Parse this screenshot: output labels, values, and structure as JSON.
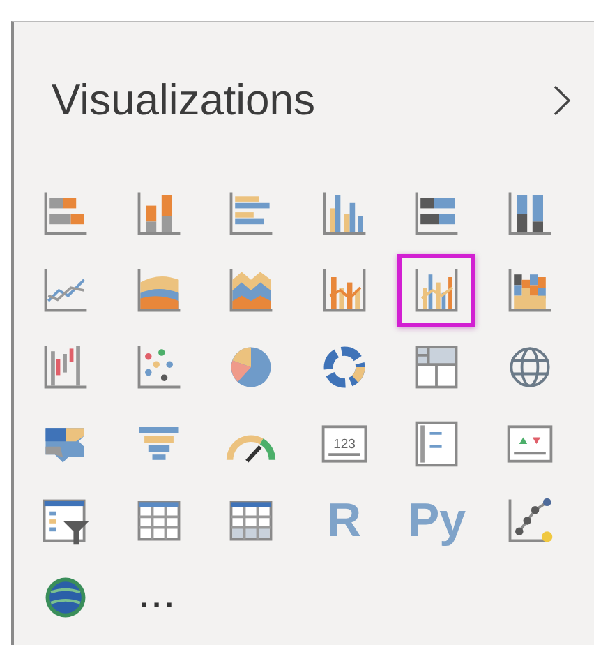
{
  "pane": {
    "title": "Visualizations"
  },
  "items": [
    {
      "kind": "stacked-bar",
      "selected": false
    },
    {
      "kind": "stacked-column",
      "selected": false
    },
    {
      "kind": "clustered-bar",
      "selected": false
    },
    {
      "kind": "clustered-column",
      "selected": false
    },
    {
      "kind": "stacked-bar-100",
      "selected": false
    },
    {
      "kind": "stacked-column-100",
      "selected": false
    },
    {
      "kind": "line",
      "selected": false
    },
    {
      "kind": "area",
      "selected": false
    },
    {
      "kind": "stacked-area",
      "selected": false
    },
    {
      "kind": "line-column",
      "selected": false
    },
    {
      "kind": "line-clustered-column",
      "selected": true
    },
    {
      "kind": "ribbon",
      "selected": false
    },
    {
      "kind": "waterfall",
      "selected": false
    },
    {
      "kind": "scatter",
      "selected": false
    },
    {
      "kind": "pie",
      "selected": false
    },
    {
      "kind": "donut",
      "selected": false
    },
    {
      "kind": "treemap",
      "selected": false
    },
    {
      "kind": "map",
      "selected": false
    },
    {
      "kind": "filled-map",
      "selected": false
    },
    {
      "kind": "funnel",
      "selected": false
    },
    {
      "kind": "gauge",
      "selected": false
    },
    {
      "kind": "card",
      "selected": false,
      "label": "123"
    },
    {
      "kind": "multi-row-card",
      "selected": false
    },
    {
      "kind": "kpi",
      "selected": false
    },
    {
      "kind": "slicer",
      "selected": false
    },
    {
      "kind": "table",
      "selected": false
    },
    {
      "kind": "matrix",
      "selected": false
    },
    {
      "kind": "text",
      "selected": false,
      "label": "R"
    },
    {
      "kind": "text",
      "selected": false,
      "label": "Py"
    },
    {
      "kind": "key-influencers",
      "selected": false
    },
    {
      "kind": "globe",
      "selected": false
    },
    {
      "kind": "more",
      "selected": false,
      "label": "..."
    }
  ]
}
